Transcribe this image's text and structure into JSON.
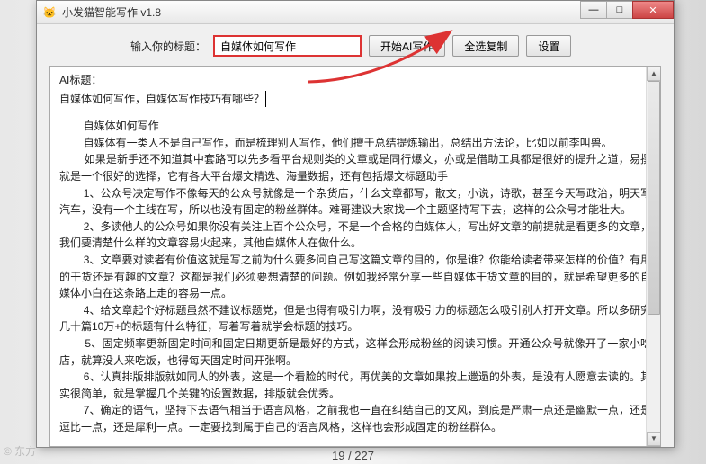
{
  "window": {
    "title": "小发猫智能写作 v1.8",
    "icon": "🐱"
  },
  "controls": {
    "min": "—",
    "max": "□",
    "close": "✕"
  },
  "form": {
    "label": "输入你的标题：",
    "title_value": "自媒体如何写作",
    "btn_ai": "开始AI写作",
    "btn_copy": "全选复制",
    "btn_settings": "设置"
  },
  "output": {
    "heading": "AI标题：",
    "subtitle": "自媒体如何写作，自媒体写作技巧有哪些？",
    "body": "        自媒体如何写作\n        自媒体有一类人不是自己写作，而是梳理别人写作，他们擅于总结提炼输出，总结出方法论，比如以前李叫兽。\n        如果是新手还不知道其中套路可以先多看平台规则类的文章或是同行爆文，亦或是借助工具都是很好的提升之道，易撰就是一个很好的选择，它有各大平台爆文精选、海量数据，还有包括爆文标题助手\n        1、公众号决定写作不像每天的公众号就像是一个杂货店，什么文章都写，散文，小说，诗歌，甚至今天写政治，明天写汽车，没有一个主线在写，所以也没有固定的粉丝群体。难哥建议大家找一个主题坚持写下去，这样的公众号才能壮大。\n        2、多读他人的公众号如果你没有关注上百个公众号，不是一个合格的自媒体人，写出好文章的前提就是看更多的文章，我们要清楚什么样的文章容易火起来，其他自媒体人在做什么。\n        3、文章要对读者有价值这就是写之前为什么要多问自己写这篇文章的目的，你是谁？你能给读者带来怎样的价值？有用的干货还是有趣的文章？这都是我们必须要想清楚的问题。例如我经常分享一些自媒体干货文章的目的，就是希望更多的自媒体小白在这条路上走的容易一点。\n        4、给文章起个好标题虽然不建议标题党，但是也得有吸引力啊，没有吸引力的标题怎么吸引别人打开文章。所以多研究几十篇10万+的标题有什么特征，写着写着就学会标题的技巧。\n        5、固定频率更新固定时间和固定日期更新是最好的方式，这样会形成粉丝的阅读习惯。开通公众号就像开了一家小吃店，就算没人来吃饭，也得每天固定时间开张啊。\n        6、认真排版排版就如同人的外表，这是一个看脸的时代，再优美的文章如果按上邋遢的外表，是没有人愿意去读的。其实很简单，就是掌握几个关键的设置数据，排版就会优秀。\n        7、确定的语气，坚持下去语气相当于语言风格，之前我也一直在纠结自己的文风，到底是严肃一点还是幽默一点，还是逗比一点，还是犀利一点。一定要找到属于自己的语言风格，这样也会形成固定的粉丝群体。"
  },
  "pager": "19 / 227",
  "watermark": "© 东方"
}
